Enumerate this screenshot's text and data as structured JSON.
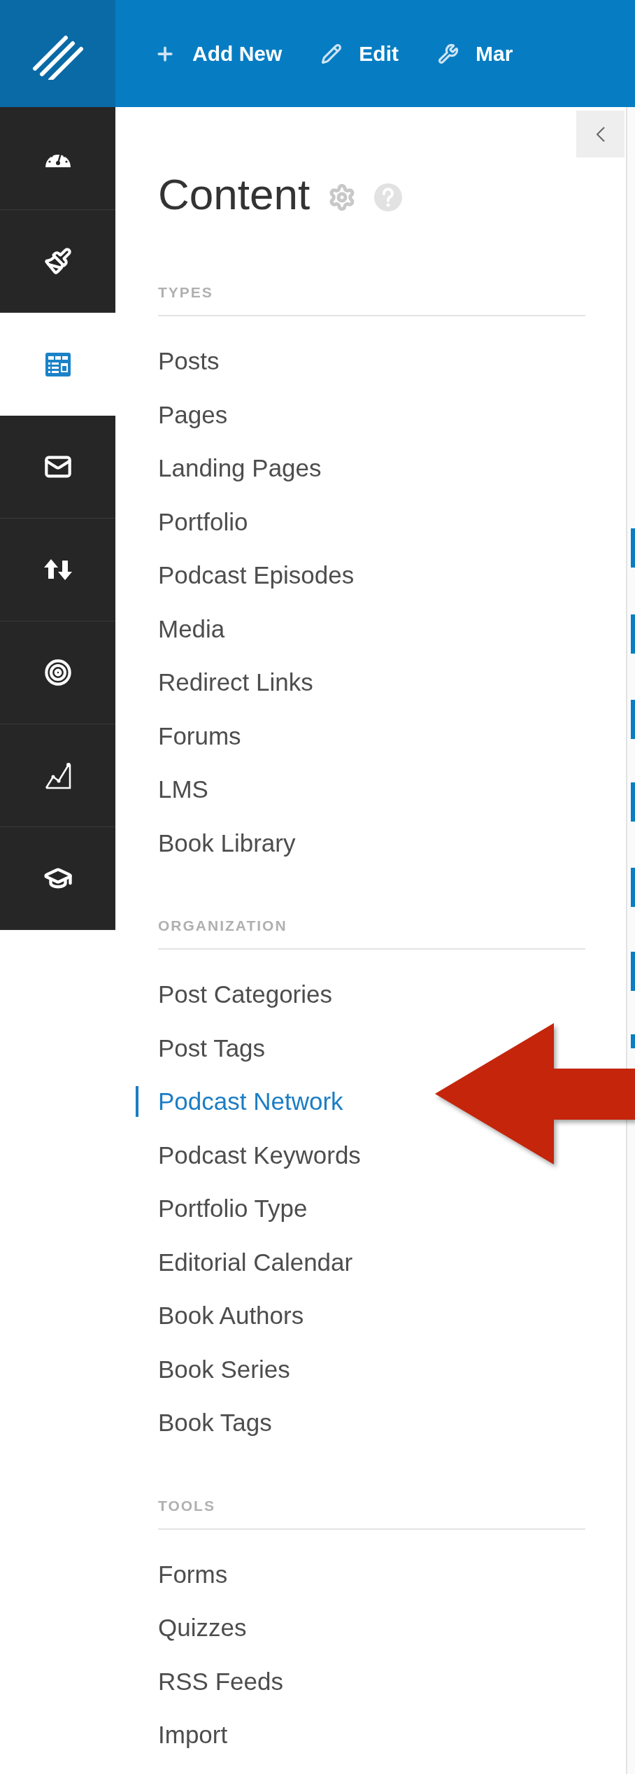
{
  "top_bar": {
    "actions": [
      {
        "kind": "add",
        "label": "Add New"
      },
      {
        "kind": "edit",
        "label": "Edit"
      },
      {
        "kind": "manage",
        "label": "Mar"
      }
    ]
  },
  "rail": {
    "items": [
      {
        "kind": "dashboard",
        "selected": false
      },
      {
        "kind": "design",
        "selected": false
      },
      {
        "kind": "content",
        "selected": true
      },
      {
        "kind": "mail",
        "selected": false
      },
      {
        "kind": "transfer",
        "selected": false
      },
      {
        "kind": "target",
        "selected": false
      },
      {
        "kind": "analytics",
        "selected": false
      },
      {
        "kind": "courses",
        "selected": false
      }
    ]
  },
  "panel": {
    "title": "Content",
    "sections": [
      {
        "heading": "TYPES",
        "items": [
          {
            "label": "Posts",
            "selected": false
          },
          {
            "label": "Pages",
            "selected": false
          },
          {
            "label": "Landing Pages",
            "selected": false
          },
          {
            "label": "Portfolio",
            "selected": false
          },
          {
            "label": "Podcast Episodes",
            "selected": false
          },
          {
            "label": "Media",
            "selected": false
          },
          {
            "label": "Redirect Links",
            "selected": false
          },
          {
            "label": "Forums",
            "selected": false
          },
          {
            "label": "LMS",
            "selected": false
          },
          {
            "label": "Book Library",
            "selected": false
          }
        ]
      },
      {
        "heading": "ORGANIZATION",
        "items": [
          {
            "label": "Post Categories",
            "selected": false
          },
          {
            "label": "Post Tags",
            "selected": false
          },
          {
            "label": "Podcast Network",
            "selected": true
          },
          {
            "label": "Podcast Keywords",
            "selected": false
          },
          {
            "label": "Portfolio Type",
            "selected": false
          },
          {
            "label": "Editorial Calendar",
            "selected": false
          },
          {
            "label": "Book Authors",
            "selected": false
          },
          {
            "label": "Book Series",
            "selected": false
          },
          {
            "label": "Book Tags",
            "selected": false
          }
        ]
      },
      {
        "heading": "TOOLS",
        "items": [
          {
            "label": "Forms",
            "selected": false
          },
          {
            "label": "Quizzes",
            "selected": false
          },
          {
            "label": "RSS Feeds",
            "selected": false
          },
          {
            "label": "Import",
            "selected": false
          }
        ]
      }
    ]
  }
}
